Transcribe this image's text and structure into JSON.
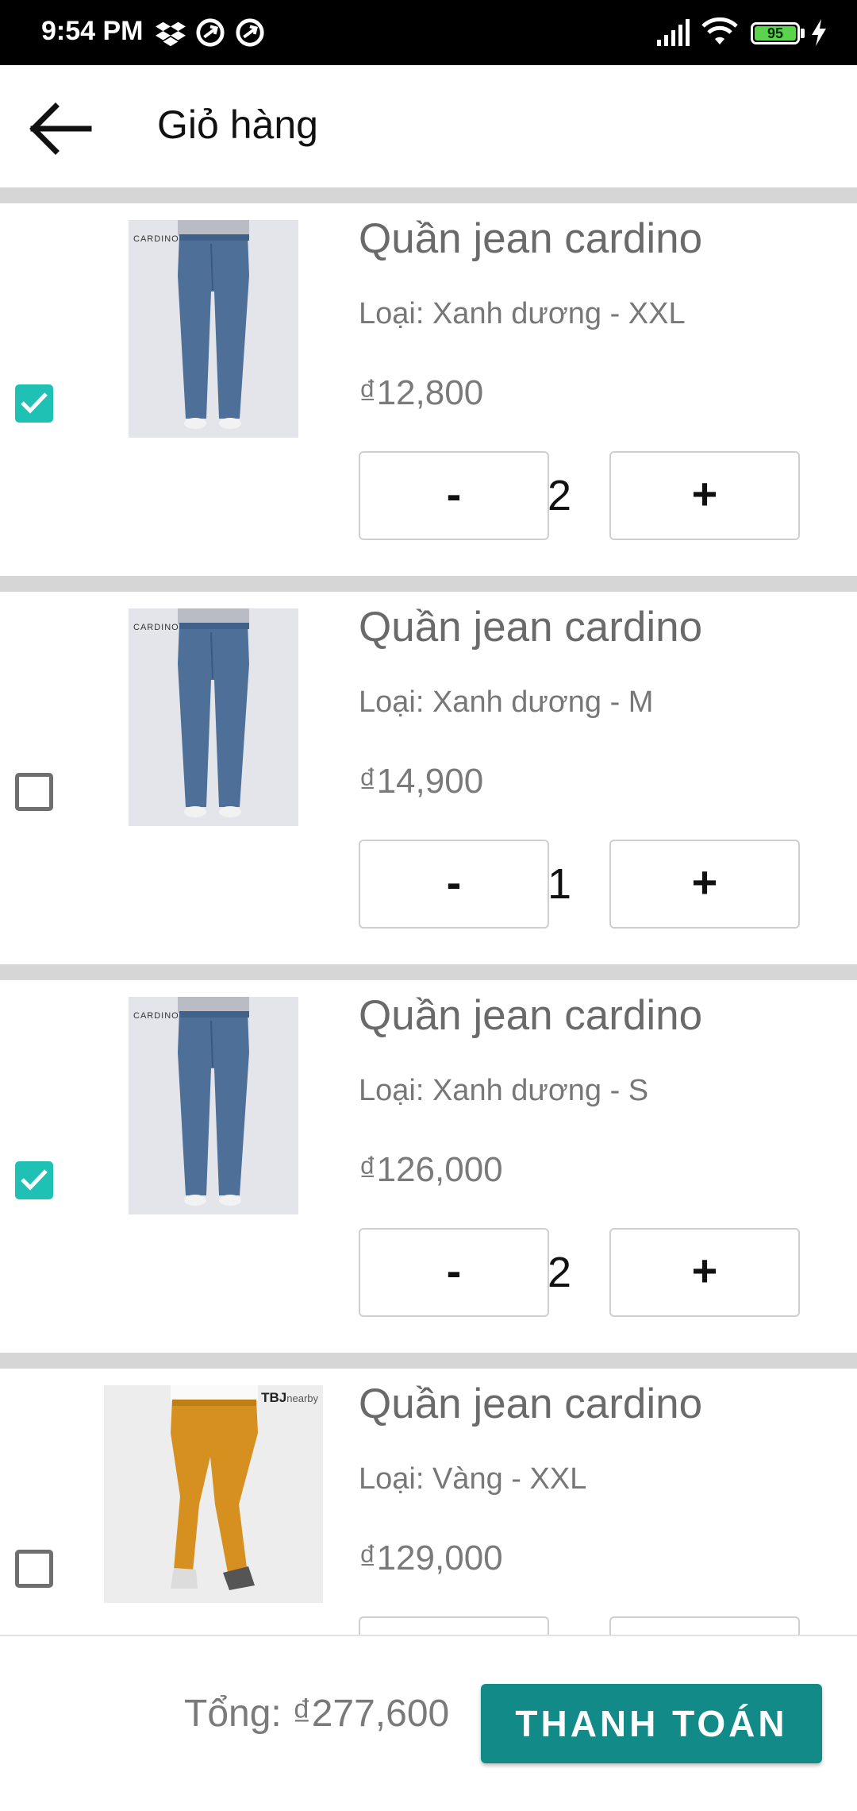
{
  "status_bar": {
    "time": "9:54 PM",
    "battery": "95"
  },
  "header": {
    "title": "Giỏ hàng"
  },
  "colors": {
    "accent": "#1fc1b4",
    "button": "#128a88",
    "separator": "#d6d6d6"
  },
  "cart": {
    "items": [
      {
        "name": "Quần jean cardino",
        "variant": "Loại: Xanh dương - XXL",
        "price": "₫12,800",
        "quantity": "2",
        "checked": true,
        "image": "jeans-blue",
        "brand": "CARDINO",
        "minus": "-",
        "plus": "+"
      },
      {
        "name": "Quần jean cardino",
        "variant": "Loại: Xanh dương - M",
        "price": "₫14,900",
        "quantity": "1",
        "checked": false,
        "image": "jeans-blue",
        "brand": "CARDINO",
        "minus": "-",
        "plus": "+"
      },
      {
        "name": "Quần jean cardino",
        "variant": "Loại: Xanh dương - S",
        "price": "₫126,000",
        "quantity": "2",
        "checked": true,
        "image": "jeans-blue",
        "brand": "CARDINO",
        "minus": "-",
        "plus": "+"
      },
      {
        "name": "Quần jean cardino",
        "variant": "Loại: Vàng - XXL",
        "price": "₫129,000",
        "quantity": "",
        "checked": false,
        "image": "chinos-yellow",
        "brand": "TBJ",
        "brand_suffix": "nearby",
        "minus": "-",
        "plus": "+"
      }
    ]
  },
  "footer": {
    "total": "Tổng: ₫277,600",
    "checkout_label": "THANH TOÁN"
  }
}
